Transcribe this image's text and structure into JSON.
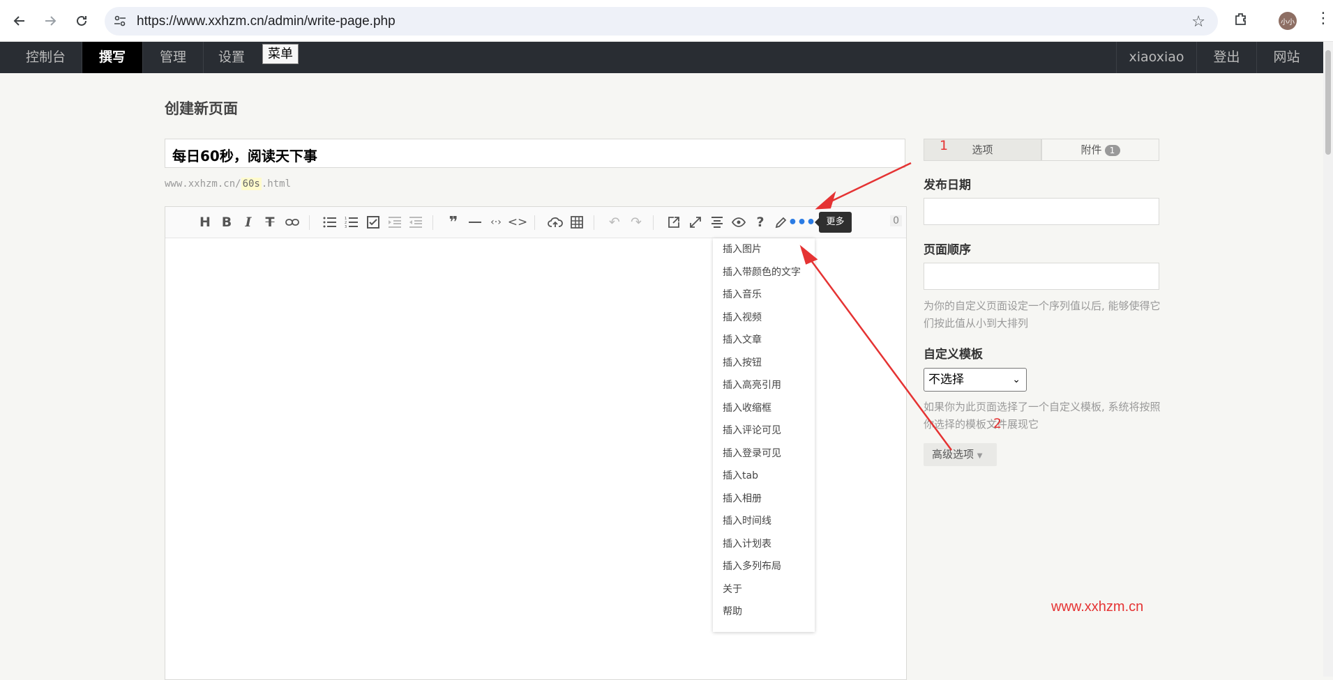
{
  "browser": {
    "url": "https://www.xxhzm.cn/admin/write-page.php",
    "avatar_text": "小小"
  },
  "adminbar": {
    "items": [
      "控制台",
      "撰写",
      "管理",
      "设置"
    ],
    "tooltip": "菜单",
    "right_items": [
      "xiaoxiao",
      "登出",
      "网站"
    ]
  },
  "page": {
    "title": "创建新页面",
    "title_value": "每日60秒，阅读天下事",
    "slug_prefix": "www.xxhzm.cn/",
    "slug_value": "60s",
    "slug_suffix": ".html"
  },
  "editor": {
    "word_count": "0",
    "more_tooltip": "更多",
    "dropdown": [
      "插入图片",
      "插入带颜色的文字",
      "插入音乐",
      "插入视频",
      "插入文章",
      "插入按钮",
      "插入高亮引用",
      "插入收缩框",
      "插入评论可见",
      "插入登录可见",
      "插入tab",
      "插入相册",
      "插入时间线",
      "插入计划表",
      "插入多列布局",
      "关于",
      "帮助"
    ]
  },
  "sidebar": {
    "tab_options": "选项",
    "tab_attachments": "附件",
    "attachments_count": "1",
    "annotation_1": "1",
    "publish_date_label": "发布日期",
    "order_label": "页面顺序",
    "order_desc": "为你的自定义页面设定一个序列值以后, 能够使得它们按此值从小到大排列",
    "template_label": "自定义模板",
    "template_selected": "不选择",
    "template_desc": "如果你为此页面选择了一个自定义模板, 系统将按照你选择的模板文件展现它",
    "annotation_2": "2",
    "advanced_label": "高级选项"
  },
  "watermark": "www.xxhzm.cn",
  "colors": {
    "annotation": "#e53333",
    "adminbar": "#292d33",
    "background": "#f6f6f3"
  }
}
